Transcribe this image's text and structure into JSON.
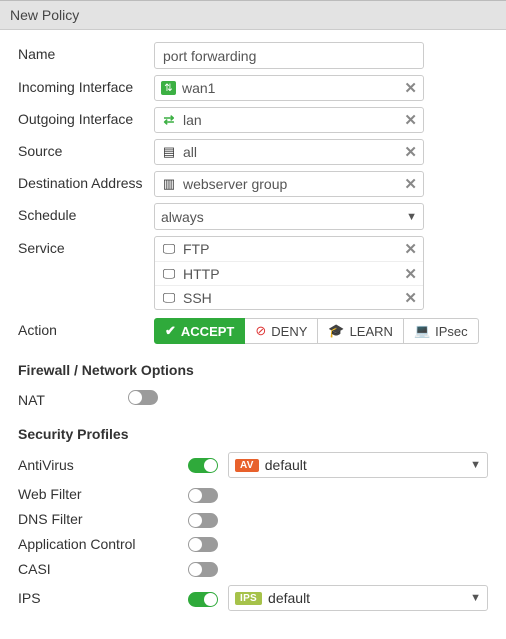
{
  "header": {
    "title": "New Policy"
  },
  "form": {
    "name_label": "Name",
    "name_value": "port forwarding",
    "incoming_label": "Incoming Interface",
    "incoming_value": "wan1",
    "outgoing_label": "Outgoing Interface",
    "outgoing_value": "lan",
    "source_label": "Source",
    "source_value": "all",
    "dest_label": "Destination Address",
    "dest_value": "webserver group",
    "schedule_label": "Schedule",
    "schedule_value": "always",
    "service_label": "Service",
    "services": [
      "FTP",
      "HTTP",
      "SSH"
    ],
    "action_label": "Action",
    "actions": {
      "accept": "ACCEPT",
      "deny": "DENY",
      "learn": "LEARN",
      "ipsec": "IPsec"
    }
  },
  "firewall": {
    "title": "Firewall / Network Options",
    "nat_label": "NAT",
    "nat_on": false
  },
  "security": {
    "title": "Security Profiles",
    "av_label": "AntiVirus",
    "av_on": true,
    "av_badge": "AV",
    "av_value": "default",
    "wf_label": "Web Filter",
    "wf_on": false,
    "dns_label": "DNS Filter",
    "dns_on": false,
    "app_label": "Application Control",
    "app_on": false,
    "casi_label": "CASI",
    "casi_on": false,
    "ips_label": "IPS",
    "ips_on": true,
    "ips_badge": "IPS",
    "ips_value": "default"
  }
}
